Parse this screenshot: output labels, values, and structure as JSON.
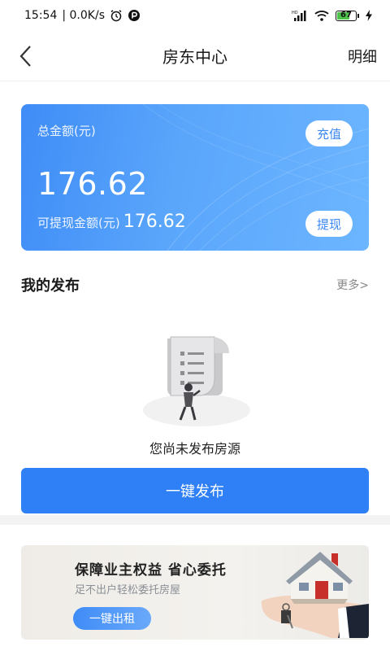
{
  "status_bar": {
    "time": "15:54",
    "net_speed": "| 0.0K/s",
    "battery": "67",
    "signal_label": "HD"
  },
  "nav": {
    "title": "房东中心",
    "right_label": "明细"
  },
  "balance": {
    "total_label": "总金额(元)",
    "total_amount": "176.62",
    "withdrawable_label": "可提现金额(元)",
    "withdrawable_amount": "176.62",
    "recharge_label": "充值",
    "withdraw_label": "提现"
  },
  "publish_section": {
    "title": "我的发布",
    "more_label": "更多>",
    "empty_text": "您尚未发布房源",
    "publish_button": "一键发布"
  },
  "banner": {
    "title": "保障业主权益  省心委托",
    "subtitle": "足不出户轻松委托房屋",
    "button": "一键出租"
  },
  "colors": {
    "primary": "#2f80f6",
    "card_gradient_start": "#3f8cf7",
    "card_gradient_end": "#6cb5ff",
    "battery_green": "#4cc14a"
  }
}
